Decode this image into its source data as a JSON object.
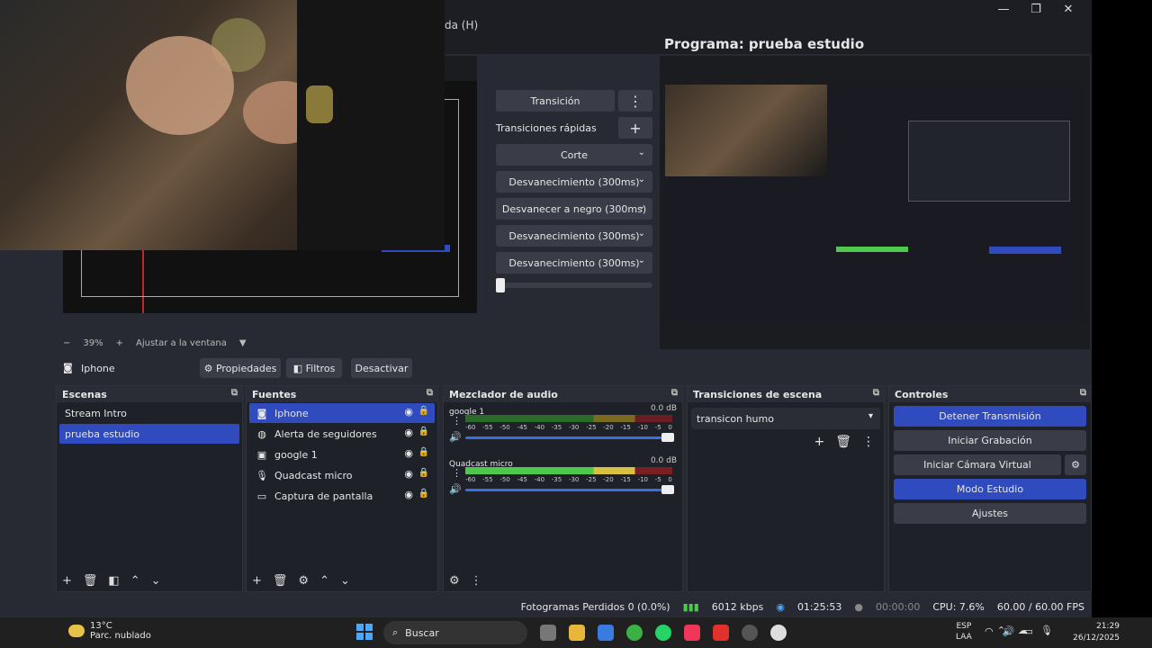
{
  "menu": {
    "tail_label": "da (H)"
  },
  "window": {
    "minimize": "—",
    "maximize": "❐",
    "close": "✕"
  },
  "program": {
    "title": "Programa: prueba estudio"
  },
  "preview": {
    "zoom": "39%",
    "zoom_minus": "−",
    "zoom_plus": "+",
    "fit_label": "Ajustar a la ventana"
  },
  "transitions_panel": {
    "transition_button": "Transición",
    "quick_label": "Transiciones rápidas",
    "items": [
      "Corte",
      "Desvanecimiento (300ms)",
      "Desvanecer a negro (300ms)",
      "Desvanecimiento (300ms)",
      "Desvanecimiento (300ms)"
    ]
  },
  "source_bar": {
    "selected_source": "Iphone",
    "properties": "Propiedades",
    "filters": "Filtros",
    "deactivate": "Desactivar"
  },
  "scenes": {
    "title": "Escenas",
    "items": [
      "Stream Intro",
      "prueba estudio"
    ],
    "selected_index": 1
  },
  "sources": {
    "title": "Fuentes",
    "items": [
      {
        "label": "Iphone",
        "icon": "camera-icon"
      },
      {
        "label": "Alerta de seguidores",
        "icon": "globe-icon"
      },
      {
        "label": "google 1",
        "icon": "image-icon"
      },
      {
        "label": "Quadcast micro",
        "icon": "microphone-icon"
      },
      {
        "label": "Captura de pantalla",
        "icon": "monitor-icon"
      }
    ],
    "selected_index": 0
  },
  "mixer": {
    "title": "Mezclador de audio",
    "channels": [
      {
        "name": "google 1",
        "db": "0.0 dB",
        "volume": 1.0
      },
      {
        "name": "Quadcast micro",
        "db": "0.0 dB",
        "volume": 1.0
      }
    ],
    "ticks": [
      "-60",
      "-55",
      "-50",
      "-45",
      "-40",
      "-35",
      "-30",
      "-25",
      "-20",
      "-15",
      "-10",
      "-5",
      "0"
    ]
  },
  "scene_transitions": {
    "title": "Transiciones de escena",
    "selected": "transicon humo"
  },
  "controls": {
    "title": "Controles",
    "stop_stream": "Detener Transmisión",
    "start_recording": "Iniciar Grabación",
    "start_virtual_cam": "Iniciar Cámara Virtual",
    "studio_mode": "Modo Estudio",
    "settings": "Ajustes"
  },
  "status": {
    "dropped_frames": "Fotogramas Perdidos 0 (0.0%)",
    "bitrate": "6012 kbps",
    "stream_time": "01:25:53",
    "rec_time": "00:00:00",
    "cpu": "CPU: 7.6%",
    "fps": "60.00 / 60.00 FPS"
  },
  "taskbar": {
    "temperature": "13°C",
    "weather": "Parc. nublado",
    "search": "Buscar",
    "lang_top": "ESP",
    "lang_bottom": "LAA",
    "time": "21:29",
    "date": "26/12/2025"
  },
  "colors": {
    "accent": "#2f4bbd",
    "panel": "#1f2128",
    "bg": "#272a33"
  }
}
